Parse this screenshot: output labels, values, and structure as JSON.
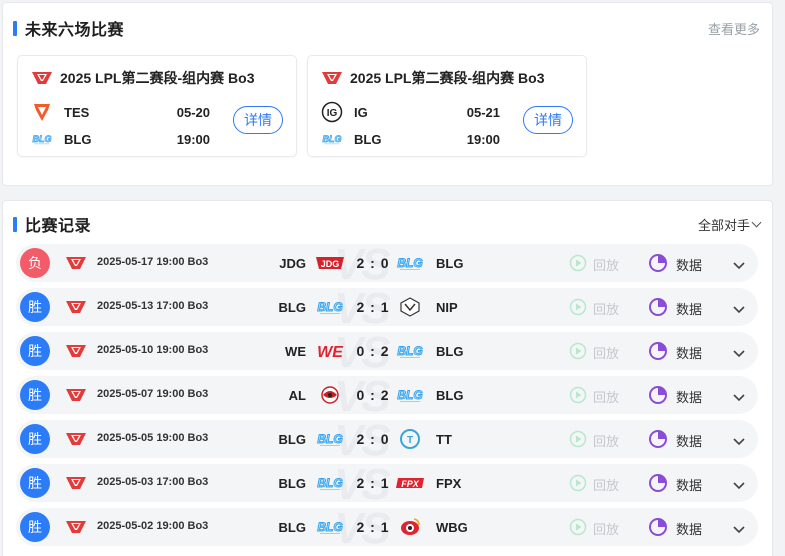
{
  "upcoming": {
    "title": "未来六场比赛",
    "more_label": "查看更多",
    "cards": [
      {
        "league": "2025 LPL第二赛段-组内赛 Bo3",
        "team1": {
          "name": "TES",
          "info": "05-20",
          "logo": "tes-logo"
        },
        "team2": {
          "name": "BLG",
          "info": "19:00",
          "logo": "blg-logo"
        },
        "button": "详情"
      },
      {
        "league": "2025 LPL第二赛段-组内赛 Bo3",
        "team1": {
          "name": "IG",
          "info": "05-21",
          "logo": "ig-logo"
        },
        "team2": {
          "name": "BLG",
          "info": "19:00",
          "logo": "blg-logo"
        },
        "button": "详情"
      }
    ]
  },
  "records": {
    "title": "比赛记录",
    "filter_label": "全部对手",
    "watermark": "VS",
    "replay_label": "回放",
    "stats_label": "数据",
    "rows": [
      {
        "result": "负",
        "outcome": "lose",
        "datetime": "2025-05-17 19:00 Bo3",
        "left": "JDG",
        "left_logo": "jdg-logo",
        "score": "2 : 0",
        "right": "BLG",
        "right_logo": "blg-logo"
      },
      {
        "result": "胜",
        "outcome": "win",
        "datetime": "2025-05-13 17:00 Bo3",
        "left": "BLG",
        "left_logo": "blg-logo",
        "score": "2 : 1",
        "right": "NIP",
        "right_logo": "nip-logo"
      },
      {
        "result": "胜",
        "outcome": "win",
        "datetime": "2025-05-10 19:00 Bo3",
        "left": "WE",
        "left_logo": "we-logo",
        "score": "0 : 2",
        "right": "BLG",
        "right_logo": "blg-logo"
      },
      {
        "result": "胜",
        "outcome": "win",
        "datetime": "2025-05-07 19:00 Bo3",
        "left": "AL",
        "left_logo": "al-logo",
        "score": "0 : 2",
        "right": "BLG",
        "right_logo": "blg-logo"
      },
      {
        "result": "胜",
        "outcome": "win",
        "datetime": "2025-05-05 19:00 Bo3",
        "left": "BLG",
        "left_logo": "blg-logo",
        "score": "2 : 0",
        "right": "TT",
        "right_logo": "tt-logo"
      },
      {
        "result": "胜",
        "outcome": "win",
        "datetime": "2025-05-03 17:00 Bo3",
        "left": "BLG",
        "left_logo": "blg-logo",
        "score": "2 : 1",
        "right": "FPX",
        "right_logo": "fpx-logo"
      },
      {
        "result": "胜",
        "outcome": "win",
        "datetime": "2025-05-02 19:00 Bo3",
        "left": "BLG",
        "left_logo": "blg-logo",
        "score": "2 : 1",
        "right": "WBG",
        "right_logo": "wbg-logo"
      }
    ]
  },
  "colors": {
    "accent": "#2b7cf6",
    "win": "#2b7cf6",
    "lose": "#f45b69",
    "stats_icon": "#8a4dd8",
    "lpl_red": "#e23b3b"
  }
}
